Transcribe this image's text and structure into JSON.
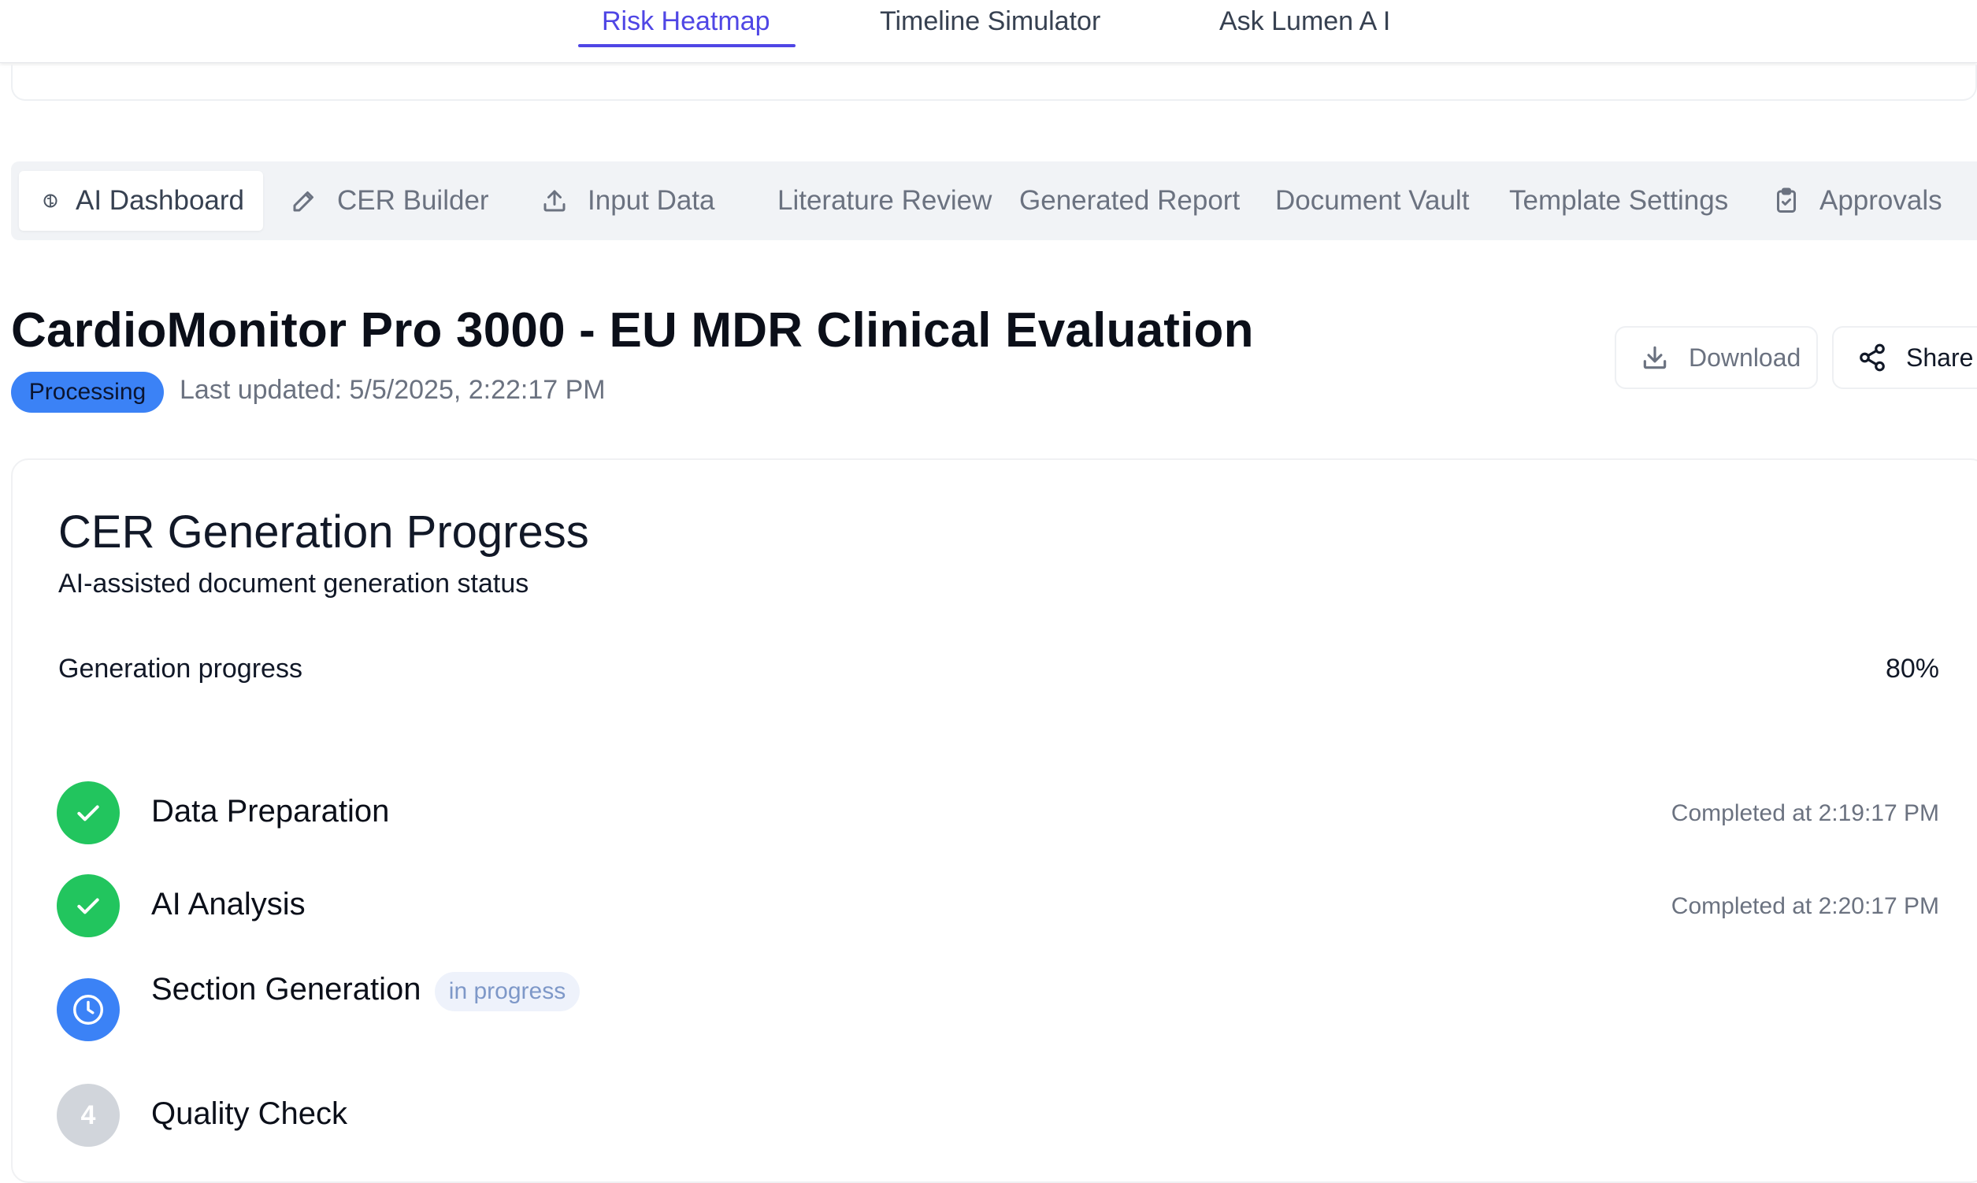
{
  "topnav": {
    "items": [
      {
        "label": "Risk Heatmap",
        "active": true
      },
      {
        "label": "Timeline Simulator",
        "active": false
      },
      {
        "label": "Ask Lumen A I",
        "active": false
      }
    ],
    "accent_color": "#4f46e5"
  },
  "tabs": [
    {
      "label": "AI Dashboard",
      "icon": "brain-icon",
      "active": true
    },
    {
      "label": "CER Builder",
      "icon": "pencil-icon",
      "active": false
    },
    {
      "label": "Input Data",
      "icon": "upload-icon",
      "active": false
    },
    {
      "label": "Literature Review",
      "icon": null,
      "active": false
    },
    {
      "label": "Generated Report",
      "icon": null,
      "active": false
    },
    {
      "label": "Document Vault",
      "icon": null,
      "active": false
    },
    {
      "label": "Template Settings",
      "icon": null,
      "active": false
    },
    {
      "label": "Approvals",
      "icon": "clipboard-check-icon",
      "active": false
    }
  ],
  "header": {
    "title": "CardioMonitor Pro 3000 - EU MDR Clinical Evaluation",
    "status": "Processing",
    "status_color": "#3b82f6",
    "last_updated": "Last updated: 5/5/2025, 2:22:17 PM",
    "download_label": "Download",
    "share_label": "Share"
  },
  "progress_card": {
    "title": "CER Generation Progress",
    "subtitle": "AI-assisted document generation status",
    "progress_label": "Generation progress",
    "progress_percent": 80,
    "progress_text": "80%",
    "steps": [
      {
        "name": "Data Preparation",
        "state": "completed",
        "time": "Completed at 2:19:17 PM",
        "icon": "check-icon"
      },
      {
        "name": "AI Analysis",
        "state": "completed",
        "time": "Completed at 2:20:17 PM",
        "icon": "check-icon"
      },
      {
        "name": "Section Generation",
        "state": "in-progress",
        "badge": "in progress",
        "icon": "clock-icon"
      },
      {
        "name": "Quality Check",
        "state": "pending",
        "number": "4"
      }
    ],
    "colors": {
      "completed": "#22c55e",
      "in_progress": "#3b82f6",
      "pending": "#d1d5db"
    }
  }
}
